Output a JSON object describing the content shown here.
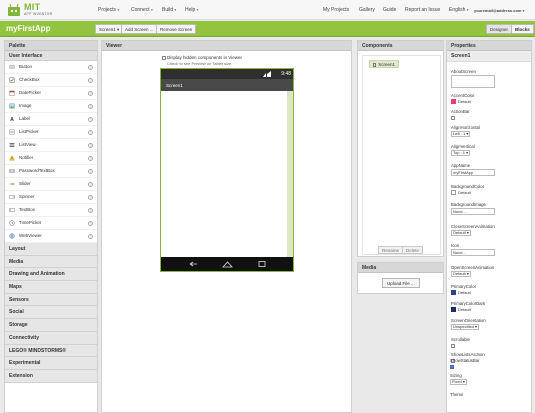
{
  "brand": {
    "name": "MIT",
    "sub": "APP INVENTOR"
  },
  "nav": {
    "projects": "Projects",
    "connect": "Connect",
    "build": "Build",
    "help": "Help",
    "my_projects": "My Projects",
    "gallery": "Gallery",
    "guide": "Guide",
    "report_issue": "Report an Issue",
    "language": "English",
    "user": "youremail@address.com"
  },
  "toolbar": {
    "project_name": "myFirstApp",
    "screen_select": "Screen1",
    "add_screen": "Add Screen ...",
    "remove_screen": "Remove Screen",
    "designer": "Designer",
    "blocks": "Blocks"
  },
  "palette": {
    "title": "Palette",
    "section": "User Interface",
    "items": [
      {
        "label": "Button",
        "icon": "button-icon"
      },
      {
        "label": "CheckBox",
        "icon": "checkbox-icon"
      },
      {
        "label": "DatePicker",
        "icon": "datepicker-icon"
      },
      {
        "label": "Image",
        "icon": "image-icon"
      },
      {
        "label": "Label",
        "icon": "label-icon"
      },
      {
        "label": "ListPicker",
        "icon": "listpicker-icon"
      },
      {
        "label": "ListView",
        "icon": "listview-icon"
      },
      {
        "label": "Notifier",
        "icon": "notifier-icon"
      },
      {
        "label": "PasswordTextBox",
        "icon": "password-icon"
      },
      {
        "label": "Slider",
        "icon": "slider-icon"
      },
      {
        "label": "Spinner",
        "icon": "spinner-icon"
      },
      {
        "label": "TextBox",
        "icon": "textbox-icon"
      },
      {
        "label": "TimePicker",
        "icon": "timepicker-icon"
      },
      {
        "label": "WebViewer",
        "icon": "webviewer-icon"
      }
    ],
    "help_glyph": "?",
    "categories": [
      "Layout",
      "Media",
      "Drawing and Animation",
      "Maps",
      "Sensors",
      "Social",
      "Storage",
      "Connectivity",
      "LEGO® MINDSTORMS®",
      "Experimental",
      "Extension"
    ]
  },
  "viewer": {
    "title": "Viewer",
    "checkbox_label": "Display hidden components in Viewer",
    "note": "Check to see Preview on Tablet size.",
    "phone_time": "9:48",
    "screen_title": "Screen1"
  },
  "components": {
    "title": "Components",
    "root": "Screen1",
    "rename": "Rename",
    "delete": "Delete"
  },
  "media": {
    "title": "Media",
    "upload": "Upload File ..."
  },
  "properties": {
    "title": "Properties",
    "component": "Screen1",
    "about_screen": "AboutScreen",
    "accent_color": "AccentColor",
    "accent_value": "Default",
    "action_bar": "ActionBar",
    "align_horizontal": "AlignHorizontal",
    "align_horizontal_value": "Left : 1",
    "align_vertical": "AlignVertical",
    "align_vertical_value": "Top : 1",
    "app_name": "AppName",
    "app_name_value": "myFirstApp",
    "background_color": "BackgroundColor",
    "background_color_value": "Default",
    "background_image": "BackgroundImage",
    "background_image_value": "None...",
    "close_anim": "CloseScreenAnimation",
    "close_anim_value": "Default",
    "icon": "Icon",
    "icon_value": "None...",
    "open_anim": "OpenScreenAnimation",
    "open_anim_value": "Default",
    "primary_color": "PrimaryColor",
    "primary_color_value": "Default",
    "primary_color_dark": "PrimaryColorDark",
    "primary_color_dark_value": "Default",
    "screen_orientation": "ScreenOrientation",
    "screen_orientation_value": "Unspecified",
    "scrollable": "Scrollable",
    "show_lists_as_json": "ShowListsAsJson",
    "show_status_bar": "ShowStatusBar",
    "sizing": "Sizing",
    "sizing_value": "Fixed",
    "theme": "Theme"
  },
  "colors": {
    "brand_green": "#92c43e",
    "accent_pink": "#e0446e",
    "primary_navy": "#2c3e8c",
    "primary_dark": "#1f2c6a"
  }
}
